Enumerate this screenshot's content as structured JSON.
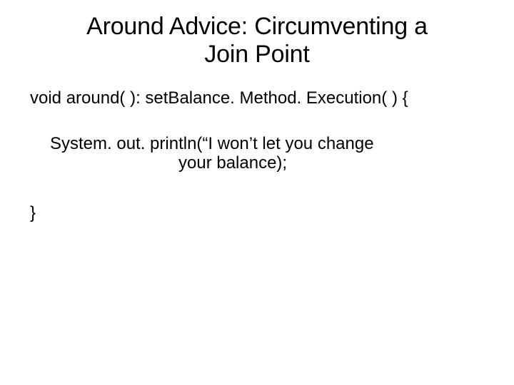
{
  "title": {
    "line1": "Around Advice: Circumventing a",
    "line2": "Join Point"
  },
  "code": {
    "signature": "void around( ): setBalance. Method. Execution( ) {",
    "stmt_a": "System. out. println(“I won’t let you change",
    "stmt_b": "your balance);",
    "close": "}"
  }
}
